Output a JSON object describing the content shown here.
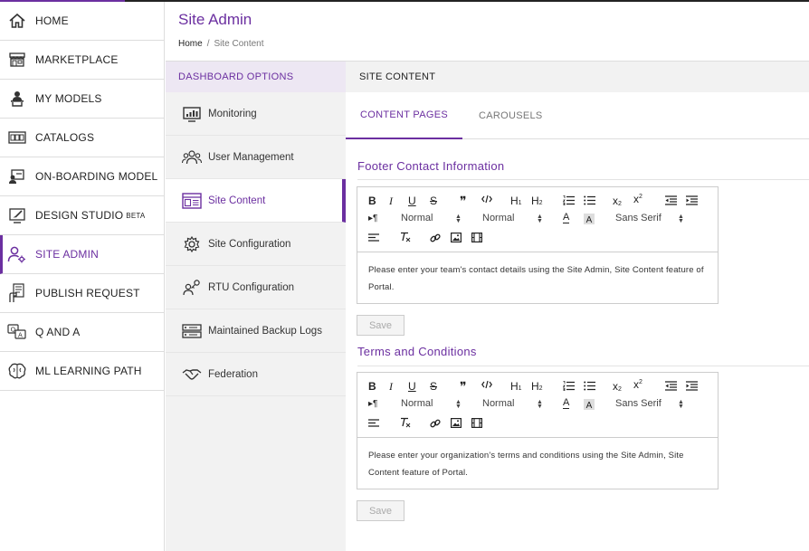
{
  "nav": {
    "items": [
      {
        "label": "HOME",
        "icon": "home-icon"
      },
      {
        "label": "MARKETPLACE",
        "icon": "store-icon"
      },
      {
        "label": "MY MODELS",
        "icon": "user-laptop-icon"
      },
      {
        "label": "CATALOGS",
        "icon": "catalog-icon"
      },
      {
        "label": "ON-BOARDING MODEL",
        "icon": "onboarding-icon"
      },
      {
        "label": "DESIGN STUDIO",
        "sup": "BETA",
        "icon": "design-icon"
      },
      {
        "label": "SITE ADMIN",
        "icon": "user-gear-icon"
      },
      {
        "label": "PUBLISH REQUEST",
        "icon": "publish-icon"
      },
      {
        "label": "Q AND A",
        "icon": "qa-icon"
      },
      {
        "label": "ML LEARNING PATH",
        "icon": "brain-icon"
      }
    ]
  },
  "header": {
    "title": "Site Admin",
    "breadcrumb": {
      "home": "Home",
      "sep": "/",
      "current": "Site Content"
    }
  },
  "dashboard": {
    "heading": "DASHBOARD OPTIONS",
    "items": [
      {
        "label": "Monitoring",
        "icon": "monitor-chart-icon"
      },
      {
        "label": "User Management",
        "icon": "users-icon"
      },
      {
        "label": "Site Content",
        "icon": "layout-icon"
      },
      {
        "label": "Site Configuration",
        "icon": "gear-icon"
      },
      {
        "label": "RTU Configuration",
        "icon": "key-user-icon"
      },
      {
        "label": "Maintained Backup Logs",
        "icon": "server-icon"
      },
      {
        "label": "Federation",
        "icon": "handshake-icon"
      }
    ]
  },
  "content": {
    "heading": "SITE CONTENT",
    "tabs": [
      {
        "label": "CONTENT PAGES"
      },
      {
        "label": "CAROUSELS"
      }
    ],
    "toolbar": {
      "header_select": "Normal",
      "size_select": "Normal",
      "font_select": "Sans Serif",
      "sub": "x",
      "sub_mark": "2",
      "sup": "x",
      "sup_mark": "2",
      "h1": "H",
      "h1_mark": "1",
      "h2": "H",
      "h2_mark": "2",
      "para": "▸¶",
      "quote": "❞"
    },
    "sections": [
      {
        "title": "Footer Contact Information",
        "body": "Please enter your team's contact details using the Site Admin, Site Content feature of Portal.",
        "save_label": "Save"
      },
      {
        "title": "Terms and Conditions",
        "body": "Please enter your organization's terms and conditions using the Site Admin, Site Content feature of Portal.",
        "save_label": "Save"
      }
    ]
  },
  "colors": {
    "accent": "#6b2fa0",
    "panel": "#f2f2f2",
    "panel_head": "#ede7f3"
  }
}
